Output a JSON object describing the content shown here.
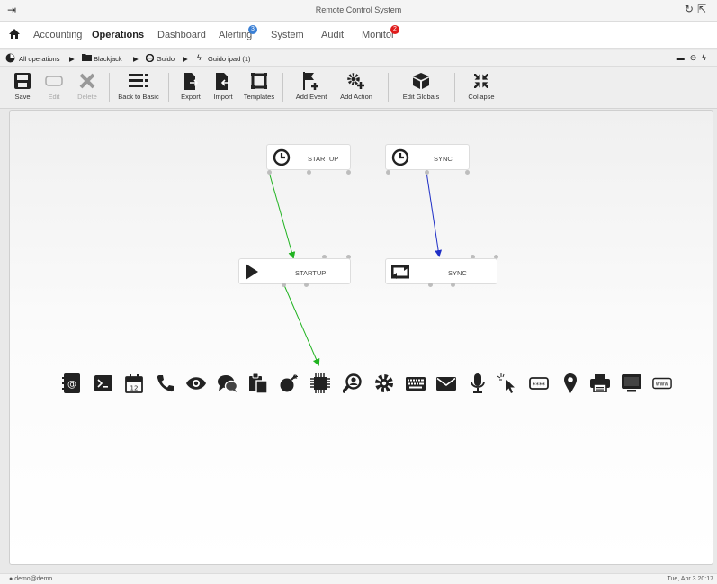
{
  "window": {
    "title": "Remote Control System"
  },
  "menu": {
    "items": [
      {
        "label": "Accounting"
      },
      {
        "label": "Operations"
      },
      {
        "label": "Dashboard"
      },
      {
        "label": "Alerting",
        "badge": "3"
      },
      {
        "label": "System"
      },
      {
        "label": "Audit"
      },
      {
        "label": "Monitor",
        "badge": "2"
      }
    ]
  },
  "breadcrumb": {
    "items": [
      "All operations",
      "Blackjack",
      "Guido",
      "Guido ipad (1)"
    ]
  },
  "toolbar": {
    "buttons": [
      {
        "label": "Save",
        "icon": "floppy-icon"
      },
      {
        "label": "Edit",
        "icon": "edit-icon"
      },
      {
        "label": "Delete",
        "icon": "delete-icon"
      },
      {
        "label": "Back to Basic",
        "icon": "list-icon"
      },
      {
        "label": "Export",
        "icon": "export-icon"
      },
      {
        "label": "Import",
        "icon": "import-icon"
      },
      {
        "label": "Templates",
        "icon": "templates-icon"
      },
      {
        "label": "Add Event",
        "icon": "flag-plus-icon"
      },
      {
        "label": "Add Action",
        "icon": "gear-plus-icon"
      },
      {
        "label": "Edit Globals",
        "icon": "cube-icon"
      },
      {
        "label": "Collapse",
        "icon": "collapse-icon"
      }
    ]
  },
  "nodes": {
    "event_startup": {
      "label": "STARTUP"
    },
    "event_sync": {
      "label": "SYNC"
    },
    "action_startup": {
      "label": "STARTUP"
    },
    "action_sync": {
      "label": "SYNC"
    }
  },
  "palette": {
    "icons": [
      "addressbook-icon",
      "terminal-icon",
      "calendar-icon",
      "phone-icon",
      "eye-icon",
      "chat-icon",
      "clipboard-icon",
      "bomb-icon",
      "chip-icon",
      "search-user-icon",
      "gear-icon",
      "keyboard-icon",
      "envelope-icon",
      "microphone-icon",
      "pointer-icon",
      "password-icon",
      "map-pin-icon",
      "printer-icon",
      "screen-icon",
      "www-icon"
    ],
    "calendar_day": "12",
    "password_text": "****",
    "www_text": "www"
  },
  "colors": {
    "green_link": "#21b321",
    "blue_link": "#1f2fc6"
  },
  "status": {
    "user": "demo@demo",
    "datetime": "Tue, Apr 3  20:17"
  }
}
